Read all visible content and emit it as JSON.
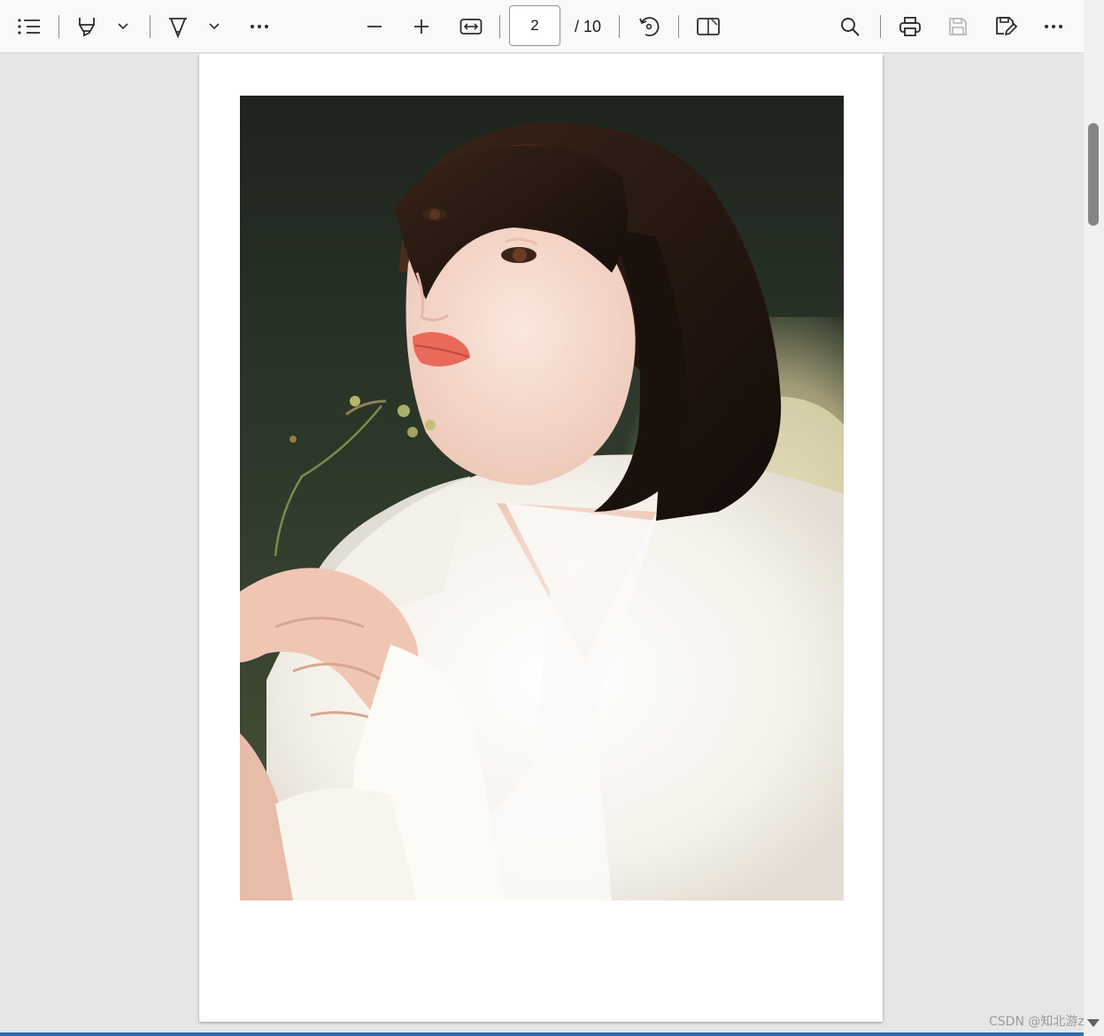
{
  "toolbar": {
    "buttons": {
      "contents": "contents-icon",
      "draw": "highlighter-icon",
      "draw_menu": "chevron-down-icon",
      "highlight": "pen-icon",
      "highlight_menu": "chevron-down-icon",
      "more_tools": "more-horizontal-icon",
      "zoom_out": "minus-icon",
      "zoom_in": "plus-icon",
      "fit_page": "fit-width-icon",
      "rotate": "rotate-icon",
      "page_view": "page-view-icon",
      "search": "search-icon",
      "print": "print-icon",
      "save": "save-icon",
      "save_as": "save-as-icon",
      "settings_more": "more-horizontal-icon"
    },
    "page_number": "2",
    "page_total": "/ 10"
  },
  "document": {
    "current_page": 2,
    "total_pages": 10,
    "image": "portrait-photo"
  },
  "scrollbar": {
    "position": 0.11
  },
  "watermark": "CSDN @知北游z",
  "colors": {
    "toolbar_bg": "#f9f9f9",
    "viewer_bg": "#e6e6e6",
    "page_bg": "#ffffff",
    "icon": "#2c2c2c",
    "accent": "#2b6cb0"
  }
}
